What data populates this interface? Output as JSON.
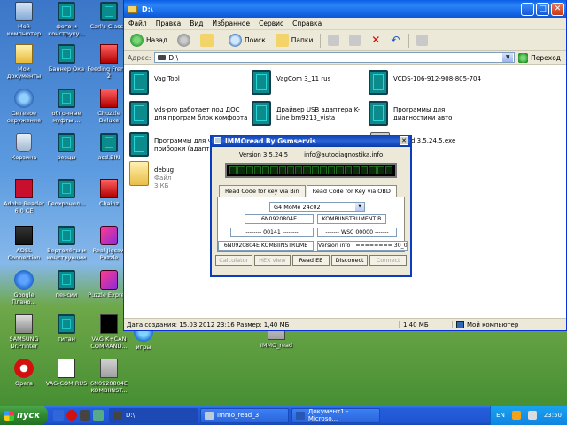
{
  "desktop": {
    "icons": [
      {
        "label": "Мой компьютер",
        "icon": "computer-icon"
      },
      {
        "label": "фото и конструку...",
        "icon": "file-icon"
      },
      {
        "label": "Carl's Classic",
        "icon": "file-icon"
      },
      {
        "label": "Мои документы",
        "icon": "documents-icon"
      },
      {
        "label": "Баннер Ока",
        "icon": "file-icon"
      },
      {
        "label": "Feeding Frenzy 2",
        "icon": "game-icon"
      },
      {
        "label": "Сетевое окружение",
        "icon": "network-icon"
      },
      {
        "label": "обгонные муфты ...",
        "icon": "file-icon"
      },
      {
        "label": "Chuzzle Deluxe",
        "icon": "game-icon"
      },
      {
        "label": "Корзина",
        "icon": "recycle-bin-icon"
      },
      {
        "label": "резцы",
        "icon": "file-icon"
      },
      {
        "label": "asd.BIN",
        "icon": "file-icon"
      },
      {
        "label": "Adobe Reader 6.0 CE",
        "icon": "pdf-icon"
      },
      {
        "label": "Геохронол...",
        "icon": "file-icon"
      },
      {
        "label": "Chainz",
        "icon": "game-icon"
      },
      {
        "label": "ADSL Connection",
        "icon": "adsl-icon"
      },
      {
        "label": "Вертолёты и конструкции",
        "icon": "file-icon"
      },
      {
        "label": "Real Jigsaw Puzzle",
        "icon": "puzzle-icon"
      },
      {
        "label": "Google Плано...",
        "icon": "google-icon"
      },
      {
        "label": "пенсии",
        "icon": "file-icon"
      },
      {
        "label": "Puzzle Expre...",
        "icon": "puzzle-icon"
      },
      {
        "label": "SAMSUNG Dr.Printer",
        "icon": "printer-icon"
      },
      {
        "label": "титан",
        "icon": "file-icon"
      },
      {
        "label": "VAG K+CAN COMMAND...",
        "icon": "vag-icon"
      },
      {
        "label": "Opera",
        "icon": "opera-icon"
      },
      {
        "label": "VAG-COM RUS",
        "icon": "vagcom-icon"
      },
      {
        "label": "6N0920804E KOMBIINST...",
        "icon": "exe-icon"
      },
      {
        "label": "игры",
        "icon": "ie-icon"
      },
      {
        "label": "IMMO_read",
        "icon": "exe-icon"
      }
    ]
  },
  "explorer": {
    "title": "D:\\",
    "menu": [
      "Файл",
      "Правка",
      "Вид",
      "Избранное",
      "Сервис",
      "Справка"
    ],
    "toolbar": {
      "back_label": "Назад",
      "search_label": "Поиск",
      "folders_label": "Папки"
    },
    "address": {
      "label": "Адрес:",
      "value": "D:\\",
      "go_label": "Переход"
    },
    "files": [
      {
        "name": "Vag Tool",
        "meta": ""
      },
      {
        "name": "VagCom 3_11 rus",
        "meta": ""
      },
      {
        "name": "VCDS-106-912-908-805-704",
        "meta": ""
      },
      {
        "name": "vds-pro работает под ДОС для програм блок комфорта",
        "meta": ""
      },
      {
        "name": "Драйвер USB адаптера K-Line bm9213_vista",
        "meta": ""
      },
      {
        "name": "Программы для диагностики авто",
        "meta": ""
      },
      {
        "name": "Программы для чтения с приборки (адапт...",
        "meta": ""
      },
      {
        "name": "...read 3.5.24.5.exe",
        "meta": ""
      },
      {
        "name": "debug",
        "meta": "Файл\n3 КБ"
      }
    ],
    "debug_type": "Файл",
    "debug_size": "3 КБ",
    "status": {
      "left": "Дата создания: 15.03.2012 23:16 Размер: 1,40 МБ",
      "size": "1,40 МБ",
      "location": "Мой компьютер"
    }
  },
  "immo": {
    "title": "IMMOread  By Gsmservis",
    "version": "Version 3.5.24.5",
    "email": "info@autodiagnostika.info",
    "tabs": [
      "Read Code for key via Bin",
      "Read  Code for Key via OBD"
    ],
    "combo_value": "G4 MoMe 24c02",
    "fields": {
      "part_no": "6N0920804E",
      "module": "KOMBIINSTRUMENT B",
      "code": "-------- 00141 --------",
      "wsc": "------- WSC 00000 -------",
      "ident": "6N0920804E  KOMBIINSTRUME",
      "version_info": "Version info : ======== 30_08.2 ="
    },
    "buttons": [
      "Calculator",
      "HEX view",
      "Read EE",
      "Disconect",
      "Connect"
    ]
  },
  "taskbar": {
    "start_label": "пуск",
    "tasks": [
      "D:\\",
      "Immo_read_3",
      "Документ1 - Microso..."
    ],
    "lang": "EN",
    "time": "23:50"
  }
}
